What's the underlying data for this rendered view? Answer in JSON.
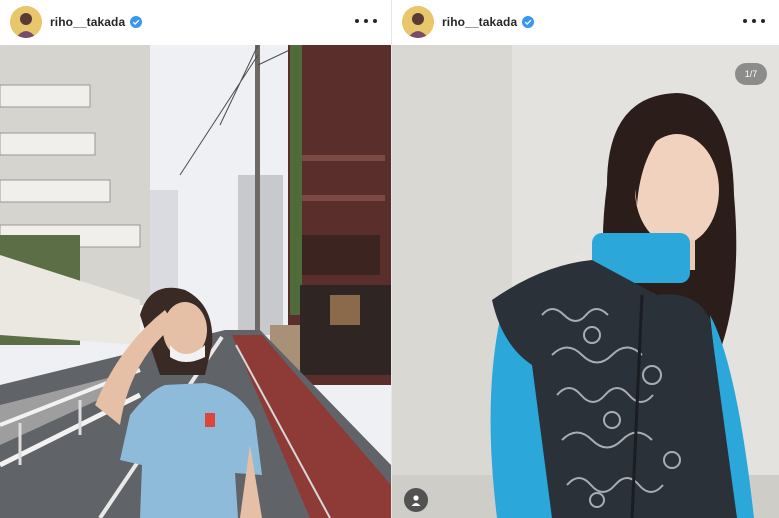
{
  "posts": [
    {
      "username": "riho__takada",
      "verified": true,
      "icons": {
        "avatar": "profile-avatar",
        "verified": "verified-badge-icon",
        "more": "more-options-icon"
      }
    },
    {
      "username": "riho__takada",
      "verified": true,
      "carousel_counter": "1/7",
      "icons": {
        "avatar": "profile-avatar",
        "verified": "verified-badge-icon",
        "more": "more-options-icon",
        "tag": "tagged-people-icon"
      }
    }
  ],
  "colors": {
    "verified": "#3897f0",
    "text": "#262626",
    "turtleneck": "#2ba7d9",
    "sky": "#eef0f2"
  }
}
